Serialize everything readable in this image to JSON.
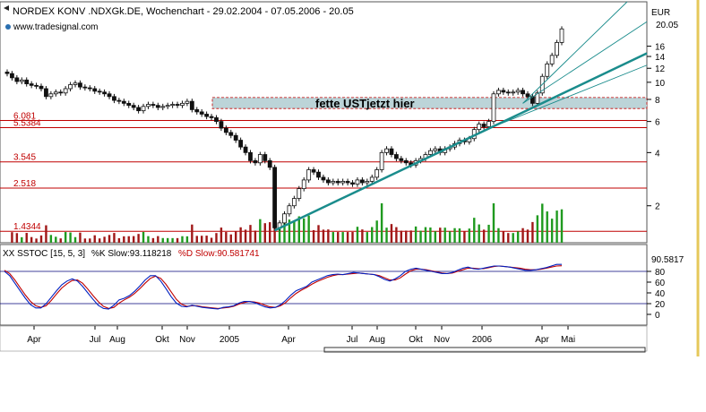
{
  "header": {
    "title": "NORDEX KONV .NDXGk.DE, Wochenchart - 29.02.2004 - 07.05.2006 - 20.05",
    "source": "www.tradesignal.com"
  },
  "chart_data": [
    {
      "type": "candlestick",
      "title": "NORDEX KONV .NDXGk.DE, Wochenchart - 29.02.2004 - 07.05.2006 - 20.05",
      "ylabel": "EUR",
      "yscale": "log",
      "ylim": [
        1.25,
        26
      ],
      "y_ticks": [
        2,
        4,
        6,
        8,
        10,
        12,
        14,
        16
      ],
      "last_price_label": "20.05",
      "x_tick_labels": [
        "Apr",
        "Jul",
        "Aug",
        "Okt",
        "Nov",
        "2005",
        "Apr",
        "Jul",
        "Aug",
        "Okt",
        "Nov",
        "2006",
        "Apr",
        "Mai"
      ],
      "horizontal_levels": [
        {
          "label": "6.081",
          "value": 6.081
        },
        {
          "label": "5.5384",
          "value": 5.5384
        },
        {
          "label": "3.545",
          "value": 3.545
        },
        {
          "label": "2.518",
          "value": 2.518
        },
        {
          "label": "1.4344",
          "value": 1.4344
        }
      ],
      "zone": {
        "label": "fette USTjetzt hier",
        "low": 7.1,
        "high": 8.2
      },
      "weeks": 115,
      "close": [
        11.2,
        10.6,
        10.1,
        10.3,
        9.8,
        9.6,
        9.5,
        9.2,
        8.3,
        8.6,
        8.8,
        8.7,
        9.2,
        9.7,
        9.9,
        9.4,
        9.3,
        9.2,
        8.9,
        8.8,
        8.6,
        8.3,
        7.9,
        7.8,
        7.6,
        7.4,
        7.2,
        6.9,
        7.3,
        7.5,
        7.4,
        7.2,
        7.3,
        7.4,
        7.5,
        7.4,
        7.6,
        7.8,
        7.0,
        6.8,
        6.6,
        6.4,
        6.3,
        6.0,
        5.5,
        5.2,
        5.0,
        4.7,
        4.3,
        4.0,
        3.6,
        3.5,
        3.9,
        3.6,
        3.3,
        1.5,
        1.6,
        1.8,
        2.0,
        2.2,
        2.5,
        2.8,
        3.2,
        3.1,
        2.9,
        2.8,
        2.7,
        2.75,
        2.7,
        2.75,
        2.7,
        2.65,
        2.8,
        2.7,
        2.75,
        2.9,
        3.2,
        4.0,
        4.2,
        3.9,
        3.7,
        3.6,
        3.5,
        3.4,
        3.6,
        3.7,
        3.9,
        4.1,
        4.2,
        4.0,
        4.2,
        4.3,
        4.5,
        4.7,
        4.6,
        4.8,
        5.4,
        5.8,
        5.6,
        6.0,
        8.6,
        9.0,
        8.8,
        8.7,
        8.8,
        9.0,
        8.6,
        8.3,
        7.6,
        8.7,
        10.8,
        12.7,
        14.2,
        16.8,
        20.05
      ],
      "stochastic": {
        "label": "XX SSTOC [15, 5, 3]",
        "k_label": "%K Slow:93.118218",
        "d_label": "%D Slow:90.581741",
        "value_label": "90.5817",
        "ylim": [
          0,
          100
        ],
        "y_ticks": [
          80,
          60,
          40,
          20,
          0
        ],
        "lines": [
          80,
          20
        ],
        "k": [
          80,
          72,
          58,
          44,
          30,
          18,
          12,
          12,
          20,
          32,
          44,
          55,
          62,
          66,
          62,
          52,
          40,
          28,
          17,
          11,
          10,
          17,
          27,
          30,
          35,
          43,
          53,
          64,
          72,
          72,
          62,
          48,
          33,
          21,
          15,
          14,
          17,
          15,
          13,
          12,
          11,
          10,
          13,
          14,
          16,
          21,
          24,
          24,
          22,
          18,
          14,
          12,
          13,
          18,
          26,
          36,
          44,
          48,
          52,
          60,
          64,
          68,
          72,
          74,
          75,
          74,
          76,
          78,
          77,
          76,
          75,
          74,
          70,
          65,
          62,
          66,
          72,
          80,
          84,
          86,
          84,
          82,
          80,
          78,
          76,
          76,
          78,
          82,
          86,
          88,
          85,
          84,
          86,
          88,
          90,
          90,
          89,
          88,
          86,
          84,
          82,
          82,
          83,
          85,
          87,
          90,
          93,
          93
        ],
        "d": [
          82,
          76,
          64,
          50,
          36,
          24,
          16,
          13,
          16,
          26,
          38,
          49,
          57,
          63,
          64,
          58,
          47,
          35,
          24,
          15,
          11,
          13,
          21,
          27,
          32,
          39,
          48,
          58,
          67,
          71,
          67,
          56,
          42,
          28,
          19,
          15,
          16,
          16,
          14,
          13,
          12,
          11,
          12,
          13,
          15,
          19,
          22,
          24,
          23,
          21,
          17,
          14,
          13,
          16,
          22,
          31,
          39,
          45,
          50,
          56,
          61,
          65,
          69,
          72,
          74,
          74,
          75,
          76,
          77,
          76,
          75,
          74,
          72,
          68,
          64,
          64,
          68,
          75,
          81,
          84,
          84,
          83,
          81,
          79,
          77,
          76,
          77,
          80,
          83,
          86,
          86,
          85,
          85,
          87,
          89,
          90,
          89,
          88,
          87,
          86,
          84,
          83,
          83,
          84,
          86,
          88,
          90,
          90.58
        ]
      }
    }
  ],
  "colors": {
    "up": "#1f9a1f",
    "down": "#a01818",
    "level": "#c00000",
    "trend": "#1a8c8c",
    "k_line": "#0020c0",
    "d_line": "#c00000",
    "grid": "#00007a"
  }
}
